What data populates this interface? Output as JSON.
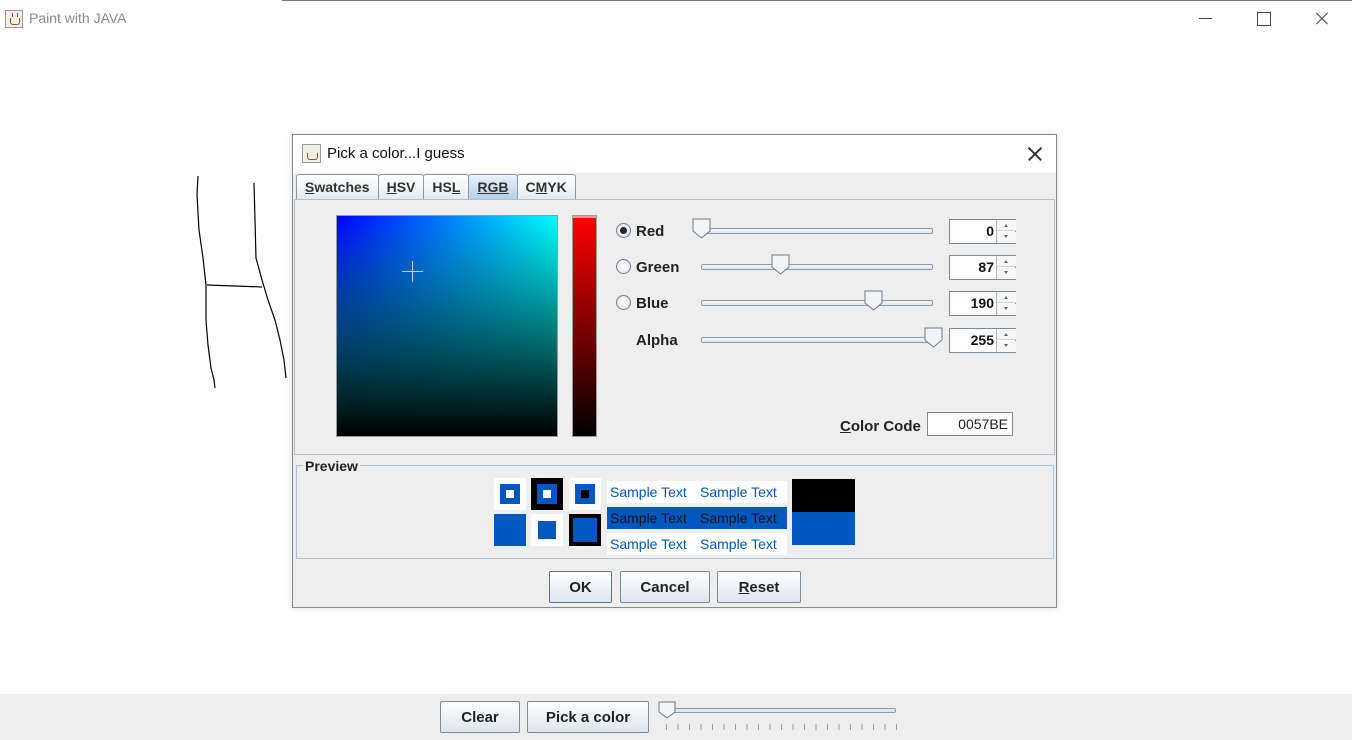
{
  "window": {
    "title": "Paint with JAVA",
    "app_icon": "java-coffee-cup-icon"
  },
  "toolbar": {
    "clear_label": "Clear",
    "pick_color_label": "Pick a color",
    "brush_size_value": 0
  },
  "dialog": {
    "title": "Pick a color...I guess",
    "tabs": [
      {
        "label_mnemonic": "S",
        "label_rest": "watches",
        "active": false
      },
      {
        "label_mnemonic": "H",
        "label_rest": "SV",
        "active": false
      },
      {
        "label_pre": "HS",
        "label_mnemonic": "L",
        "active": false
      },
      {
        "label_mnemonic": "RGB",
        "active": true
      },
      {
        "label_pre": "C",
        "label_mnemonic": "M",
        "label_rest": "YK",
        "active": false
      }
    ],
    "channels": [
      {
        "label": "Red",
        "value": "0",
        "selected": true,
        "level": 0
      },
      {
        "label": "Green",
        "value": "87",
        "selected": false,
        "level": 87
      },
      {
        "label": "Blue",
        "value": "190",
        "selected": false,
        "level": 190
      },
      {
        "label": "Alpha",
        "value": "255",
        "level": 255
      }
    ],
    "color_code_mnemonic": "C",
    "color_code_rest": "olor Code",
    "color_code_value": "0057BE",
    "preview_title": "Preview",
    "sample_text": "Sample Text",
    "selected_color": "#0057be",
    "ok_label": "OK",
    "cancel_label": "Cancel",
    "reset_mnemonic": "R",
    "reset_rest": "eset"
  }
}
